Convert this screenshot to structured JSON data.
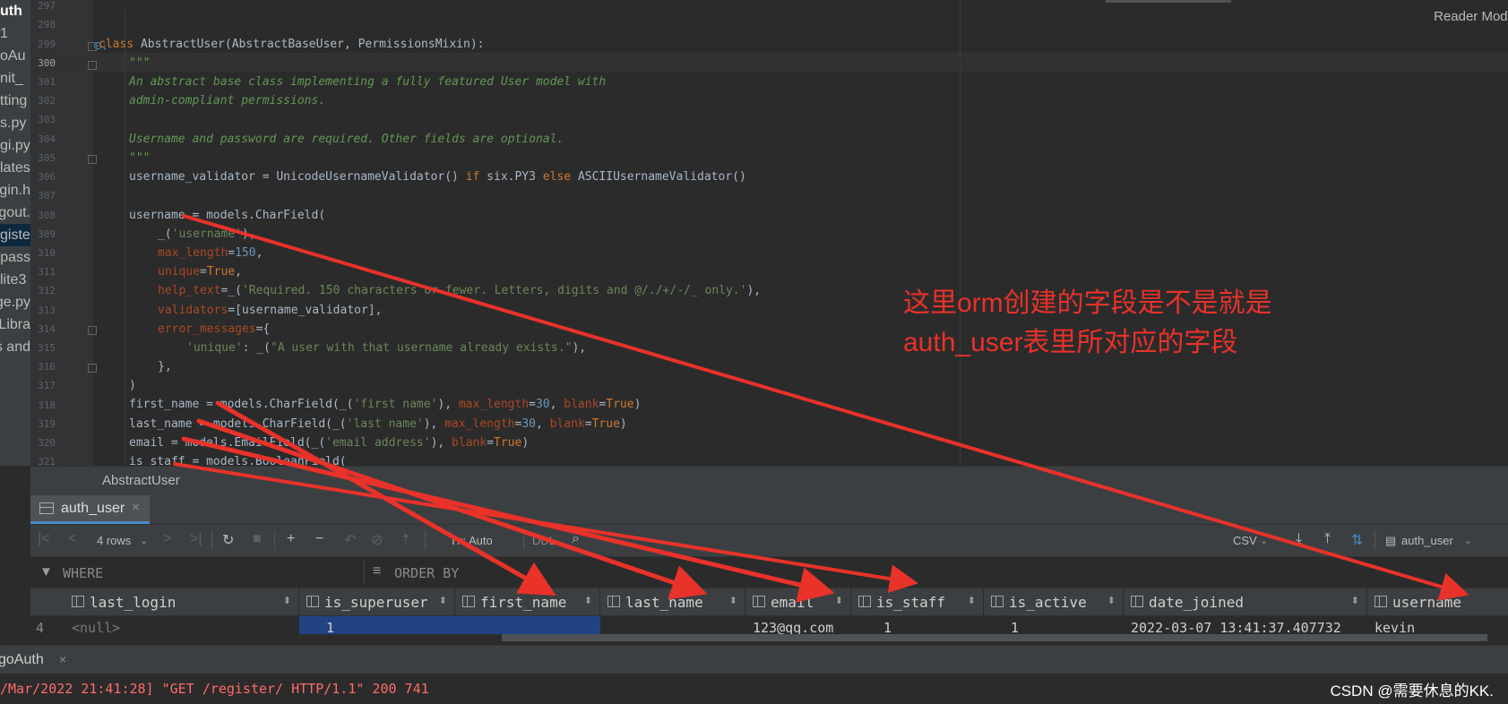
{
  "sidebar": {
    "items": [
      {
        "label": "uth",
        "bold": true
      },
      {
        "label": "1"
      },
      {
        "label": "oAu"
      },
      {
        "label": "nit_"
      },
      {
        "label": "tting"
      },
      {
        "label": "s.py"
      },
      {
        "label": "gi.py"
      },
      {
        "label": "lates"
      },
      {
        "label": "gin.h"
      },
      {
        "label": "gout."
      },
      {
        "label": "giste",
        "selected": true
      },
      {
        "label": "tpass"
      },
      {
        "label": "lite3"
      },
      {
        "label": "ge.py"
      },
      {
        "label": "Libra"
      },
      {
        "label": "s and"
      }
    ]
  },
  "editor": {
    "reader_mode": "Reader Mode",
    "line_numbers": [
      "297",
      "298",
      "299",
      "300",
      "301",
      "302",
      "303",
      "304",
      "305",
      "306",
      "307",
      "308",
      "309",
      "310",
      "311",
      "312",
      "313",
      "314",
      "315",
      "316",
      "317",
      "318",
      "319",
      "320",
      "321"
    ]
  },
  "code": {
    "l299_kw": "class ",
    "l299_rest": "AbstractUser(AbstractBaseUser, PermissionsMixin):",
    "l300": "\"\"\"",
    "l301": "An abstract base class implementing a fully featured User model with",
    "l302": "admin-compliant permissions.",
    "l304": "Username and password are required. Other fields are optional.",
    "l305": "\"\"\"",
    "l306_a": "username_validator = UnicodeUsernameValidator() ",
    "l306_if": "if ",
    "l306_b": "six.PY3 ",
    "l306_else": "else ",
    "l306_c": "ASCIIUsernameValidator()",
    "l308": "username = models.CharField(",
    "l309_a": "_(",
    "l309_s": "'username'",
    "l309_b": "),",
    "l310_k": "max_length",
    "l310_eq": "=",
    "l310_n": "150",
    "l310_c": ",",
    "l311_k": "unique",
    "l311_eq": "=",
    "l311_v": "True",
    "l311_c": ",",
    "l312_k": "help_text",
    "l312_a": "=_(",
    "l312_s": "'Required. 150 characters or fewer. Letters, digits and @/./+/-/_ only.'",
    "l312_b": "),",
    "l313_k": "validators",
    "l313_a": "=[username_validator],",
    "l314_k": "error_messages",
    "l314_a": "={",
    "l315_s1": "'unique'",
    "l315_a": ": _(",
    "l315_s2": "\"A user with that username already exists.\"",
    "l315_b": "),",
    "l316": "},",
    "l317": ")",
    "l318_a": "first_name = models.CharField(_(",
    "l318_s": "'first name'",
    "l318_b": "), ",
    "l318_k1": "max_length",
    "l318_eq1": "=",
    "l318_n": "30",
    "l318_c": ", ",
    "l318_k2": "blank",
    "l318_eq2": "=",
    "l318_v": "True",
    "l318_e": ")",
    "l319_a": "last_name = models.CharField(_(",
    "l319_s": "'last name'",
    "l319_b": "), ",
    "l319_k1": "max_length",
    "l319_eq1": "=",
    "l319_n": "30",
    "l319_c": ", ",
    "l319_k2": "blank",
    "l319_eq2": "=",
    "l319_v": "True",
    "l319_e": ")",
    "l320_a": "email = models.EmailField(_(",
    "l320_s": "'email address'",
    "l320_b": "), ",
    "l320_k": "blank",
    "l320_eq": "=",
    "l320_v": "True",
    "l320_e": ")",
    "l321": "is_staff = models.BooleanField("
  },
  "breadcrumb": "AbstractUser",
  "db_tab": {
    "label": "auth_user",
    "close": "×"
  },
  "toolbar": {
    "rows": "4 rows",
    "tx": "Tx: Auto",
    "ddl": "DDL",
    "csv": "CSV",
    "table": "auth_user"
  },
  "filter": {
    "where": "WHERE",
    "order_by": "ORDER BY"
  },
  "grid": {
    "columns": [
      "last_login",
      "is_superuser",
      "first_name",
      "last_name",
      "email",
      "is_staff",
      "is_active",
      "date_joined",
      "username"
    ],
    "row": {
      "num": "4",
      "last_login": "<null>",
      "is_superuser": "1",
      "first_name": "",
      "last_name": "",
      "email": "123@qq.com",
      "is_staff": "1",
      "is_active": "1",
      "date_joined": "2022-03-07 13:41:37.407732",
      "username": "kevin"
    }
  },
  "run": {
    "tab_label": "goAuth",
    "tab_close": "×",
    "console_line": "/Mar/2022 21:41:28] \"GET /register/ HTTP/1.1\" 200 741",
    "watermark": "CSDN @需要休息的KK."
  },
  "annotation": {
    "line1": "这里orm创建的字段是不是就是",
    "line2": "auth_user表里所对应的字段"
  },
  "colors": {
    "annotation": "#e8322a",
    "selection": "#214283"
  }
}
